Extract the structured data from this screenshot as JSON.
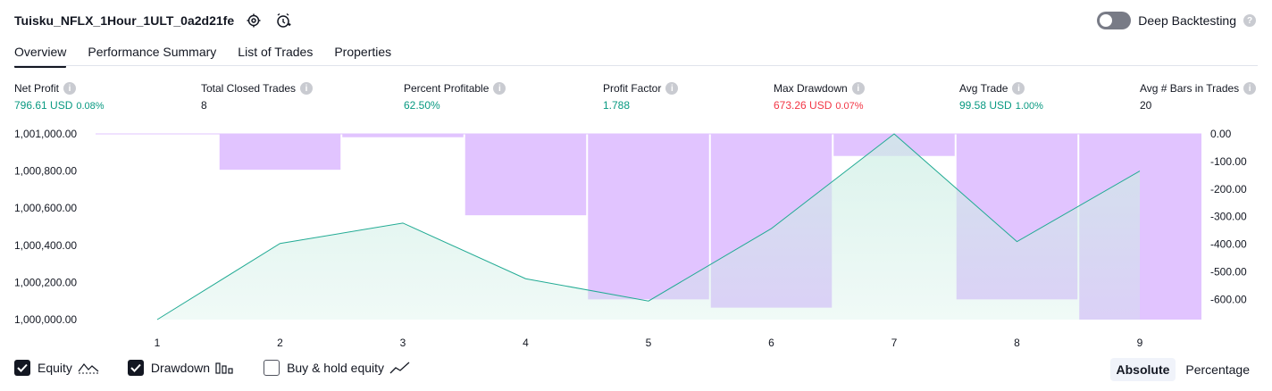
{
  "header": {
    "strategy_name": "Tuisku_NFLX_1Hour_1ULT_0a2d21fe",
    "deep_backtesting_label": "Deep Backtesting",
    "deep_backtesting_on": false
  },
  "tabs": [
    {
      "label": "Overview",
      "active": true
    },
    {
      "label": "Performance Summary",
      "active": false
    },
    {
      "label": "List of Trades",
      "active": false
    },
    {
      "label": "Properties",
      "active": false
    }
  ],
  "metrics": [
    {
      "label": "Net Profit",
      "value": "796.61 USD",
      "sub": "0.08%",
      "color": "green"
    },
    {
      "label": "Total Closed Trades",
      "value": "8",
      "sub": "",
      "color": "dark"
    },
    {
      "label": "Percent Profitable",
      "value": "62.50%",
      "sub": "",
      "color": "green"
    },
    {
      "label": "Profit Factor",
      "value": "1.788",
      "sub": "",
      "color": "green"
    },
    {
      "label": "Max Drawdown",
      "value": "673.26 USD",
      "sub": "0.07%",
      "color": "red"
    },
    {
      "label": "Avg Trade",
      "value": "99.58 USD",
      "sub": "1.00%",
      "color": "green"
    },
    {
      "label": "Avg # Bars in Trades",
      "value": "20",
      "sub": "",
      "color": "dark"
    }
  ],
  "chart_data": {
    "type": "line+bar",
    "categories": [
      "1",
      "2",
      "3",
      "4",
      "5",
      "6",
      "7",
      "8",
      "9"
    ],
    "equity": {
      "name": "Equity",
      "values": [
        1000000,
        1000410,
        1000520,
        1000220,
        1000100,
        1000490,
        1001000,
        1000420,
        1000800
      ],
      "ylim": [
        1000000,
        1001000
      ],
      "ticks": [
        "1,001,000.00",
        "1,000,800.00",
        "1,000,600.00",
        "1,000,400.00",
        "1,000,200.00",
        "1,000,000.00"
      ],
      "color": "#22ab94",
      "fill_color": "#cdeee4"
    },
    "drawdown": {
      "name": "Drawdown",
      "values": [
        0,
        -130,
        -12,
        -295,
        -600,
        -630,
        -80,
        -600,
        -673.26
      ],
      "ylim": [
        -673.26,
        0
      ],
      "ticks": [
        "0.00",
        "-100.00",
        "-200.00",
        "-300.00",
        "-400.00",
        "-500.00",
        "-600.00"
      ],
      "color": "#e1c4ff"
    }
  },
  "legend": [
    {
      "label": "Equity",
      "checked": true,
      "icon": "equity-line-icon"
    },
    {
      "label": "Drawdown",
      "checked": true,
      "icon": "drawdown-bars-icon"
    },
    {
      "label": "Buy & hold equity",
      "checked": false,
      "icon": "buy-hold-line-icon"
    }
  ],
  "mode": {
    "absolute_label": "Absolute",
    "percentage_label": "Percentage",
    "selected": "Absolute"
  }
}
